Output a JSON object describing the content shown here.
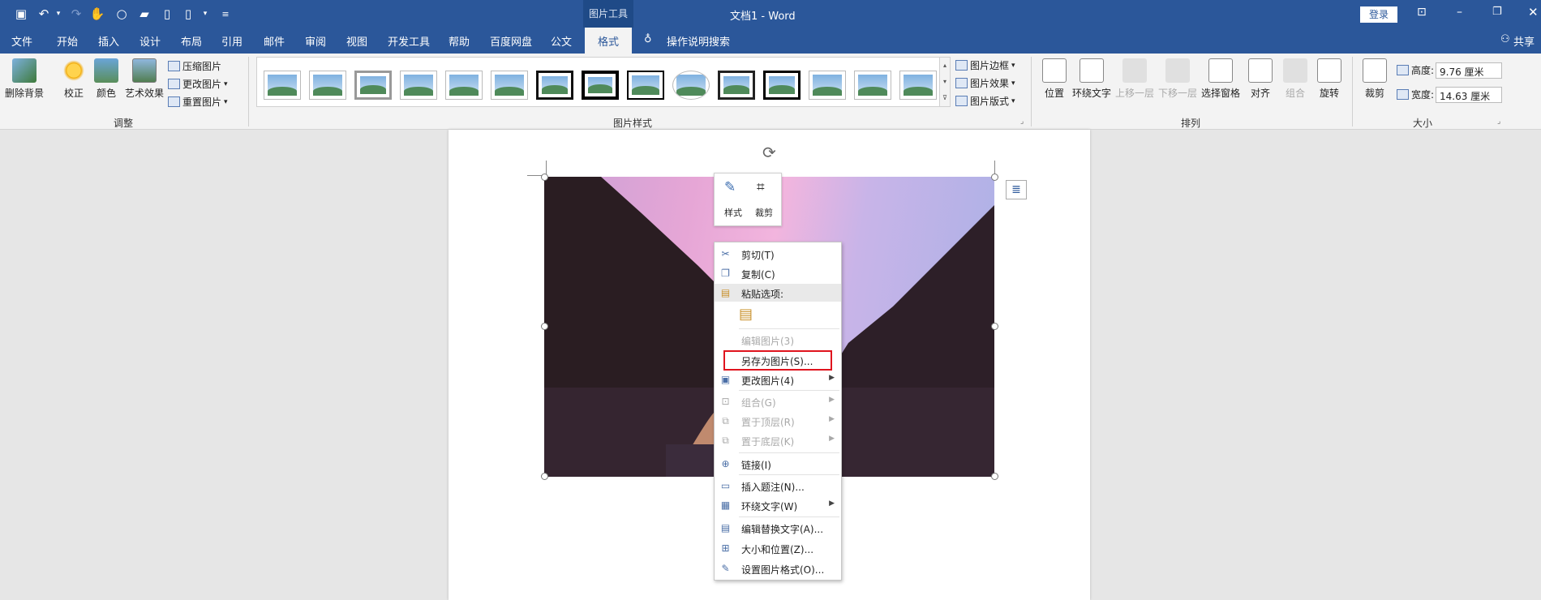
{
  "titlebar": {
    "context_tool": "图片工具",
    "title": "文档1 - Word",
    "login_label": "登录",
    "window_buttons": [
      "ribbon-display-icon",
      "minimize-icon",
      "restore-icon",
      "close-icon"
    ]
  },
  "tabs": [
    "文件",
    "开始",
    "插入",
    "设计",
    "布局",
    "引用",
    "邮件",
    "审阅",
    "视图",
    "开发工具",
    "帮助",
    "百度网盘",
    "公文",
    "格式"
  ],
  "active_tab": "格式",
  "tell_me": "操作说明搜索",
  "share_label": "共享",
  "ribbon": {
    "adjust": {
      "remove_bg": "删除背景",
      "correct": "校正",
      "color": "颜色",
      "artistic": "艺术效果",
      "compress": "压缩图片",
      "change": "更改图片",
      "reset": "重置图片",
      "group_label": "调整"
    },
    "styles": {
      "border": "图片边框",
      "effects": "图片效果",
      "layout": "图片版式",
      "group_label": "图片样式"
    },
    "arrange": {
      "position": "位置",
      "wrap": "环绕文字",
      "forward": "上移一层",
      "backward": "下移一层",
      "selection_pane": "选择窗格",
      "align": "对齐",
      "group": "组合",
      "rotate": "旋转",
      "group_label": "排列"
    },
    "size": {
      "crop": "裁剪",
      "height_label": "高度:",
      "height_value": "9.76 厘米",
      "width_label": "宽度:",
      "width_value": "14.63 厘米",
      "group_label": "大小"
    }
  },
  "mini_toolbar": {
    "style": "样式",
    "crop": "裁剪"
  },
  "context_menu": {
    "items": [
      {
        "label": "剪切(T)",
        "icon": "scissors-icon",
        "disabled": false
      },
      {
        "label": "复制(C)",
        "icon": "copy-icon",
        "disabled": false
      },
      {
        "label": "粘贴选项:",
        "icon": "paste-icon",
        "disabled": false
      },
      {
        "label": "编辑图片(3)",
        "icon": "",
        "disabled": true
      },
      {
        "label": "另存为图片(S)...",
        "icon": "",
        "disabled": false
      },
      {
        "label": "更改图片(4)",
        "icon": "change-picture-icon",
        "disabled": false
      },
      {
        "label": "组合(G)",
        "icon": "group-icon",
        "disabled": true
      },
      {
        "label": "置于顶层(R)",
        "icon": "bring-front-icon",
        "disabled": true
      },
      {
        "label": "置于底层(K)",
        "icon": "send-back-icon",
        "disabled": true
      },
      {
        "label": "链接(I)",
        "icon": "link-icon",
        "disabled": false
      },
      {
        "label": "插入题注(N)...",
        "icon": "caption-icon",
        "disabled": false
      },
      {
        "label": "环绕文字(W)",
        "icon": "wrap-icon",
        "disabled": false
      },
      {
        "label": "编辑替换文字(A)...",
        "icon": "alt-text-icon",
        "disabled": false
      },
      {
        "label": "大小和位置(Z)...",
        "icon": "size-position-icon",
        "disabled": false
      },
      {
        "label": "设置图片格式(O)...",
        "icon": "format-picture-icon",
        "disabled": false
      }
    ]
  },
  "colors": {
    "accent": "#2b579a",
    "highlight": "#e0141e"
  }
}
